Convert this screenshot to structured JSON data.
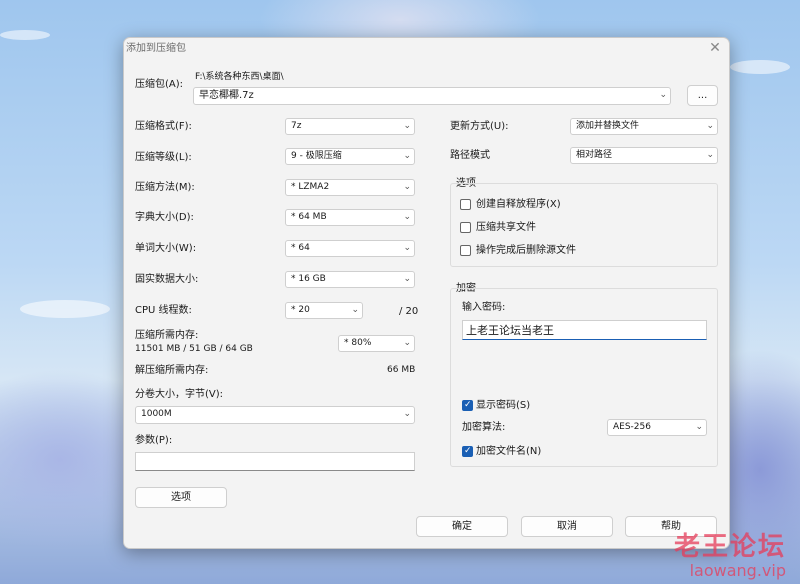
{
  "watermark": {
    "line1": "老王论坛",
    "line2": "laowang.vip"
  },
  "dialog": {
    "title": "添加到压缩包",
    "close_glyph": "✕",
    "archive": {
      "label": "压缩包(A):",
      "path": "F:\\系统各种东西\\桌面\\",
      "name": "早恋椰椰.7z",
      "browse_label": "..."
    },
    "left": {
      "format": {
        "label": "压缩格式(F):",
        "value": "7z"
      },
      "level": {
        "label": "压缩等级(L):",
        "value": "9 - 极限压缩"
      },
      "method": {
        "label": "压缩方法(M):",
        "value": "* LZMA2"
      },
      "dict": {
        "label": "字典大小(D):",
        "value": "* 64 MB"
      },
      "word": {
        "label": "单词大小(W):",
        "value": "* 64"
      },
      "solid": {
        "label": "固实数据大小:",
        "value": "* 16 GB"
      },
      "threads": {
        "label": "CPU 线程数:",
        "value": "* 20",
        "max": "/ 20"
      },
      "mem_compress": {
        "label": "压缩所需内存:",
        "detail": "11501 MB / 51 GB / 64 GB",
        "value": "* 80%"
      },
      "mem_decompress": {
        "label": "解压缩所需内存:",
        "value": "66 MB"
      },
      "volume": {
        "label": "分卷大小，字节(V):",
        "value": "1000M"
      },
      "params": {
        "label": "参数(P):",
        "value": ""
      },
      "options_button": "选项"
    },
    "right": {
      "update": {
        "label": "更新方式(U):",
        "value": "添加并替换文件"
      },
      "path_mode": {
        "label": "路径模式",
        "value": "相对路径"
      },
      "options": {
        "title": "选项",
        "items": [
          {
            "label": "创建自释放程序(X)",
            "checked": false
          },
          {
            "label": "压缩共享文件",
            "checked": false
          },
          {
            "label": "操作完成后删除源文件",
            "checked": false
          }
        ]
      },
      "encryption": {
        "title": "加密",
        "password_label": "输入密码:",
        "password": "上老王论坛当老王",
        "show_password": {
          "label": "显示密码(S)",
          "checked": true
        },
        "algo": {
          "label": "加密算法:",
          "value": "AES-256"
        },
        "encrypt_names": {
          "label": "加密文件名(N)",
          "checked": true
        }
      }
    },
    "buttons": {
      "ok": "确定",
      "cancel": "取消",
      "help": "帮助"
    }
  }
}
